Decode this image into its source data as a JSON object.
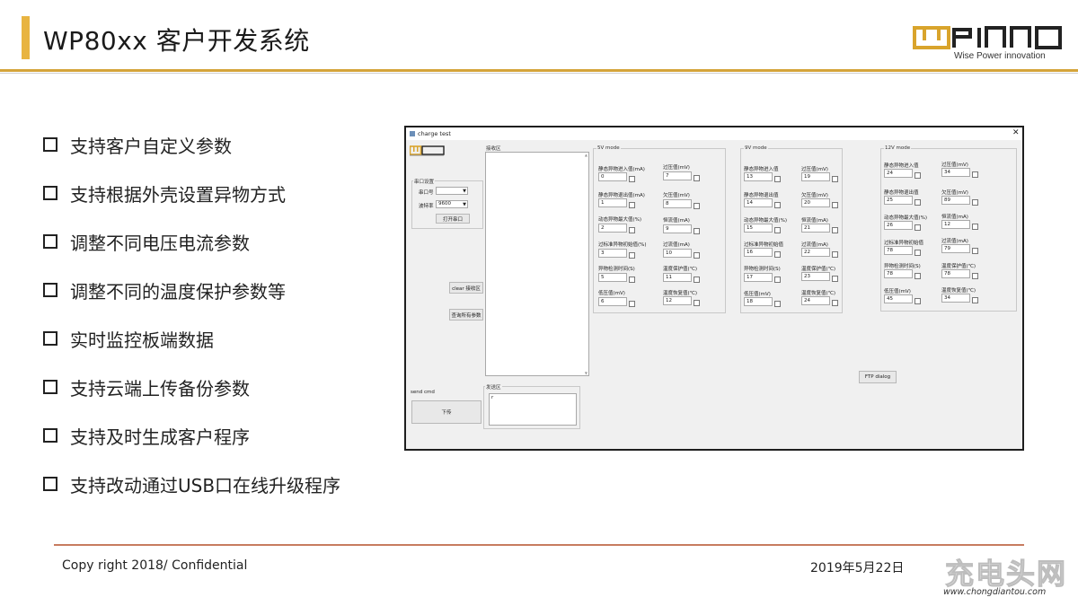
{
  "slide": {
    "title": "WP80xx 客户开发系统",
    "logo_tagline": "Wise Power innovation",
    "bullets": [
      "支持客户自定义参数",
      "支持根据外壳设置异物方式",
      "调整不同电压电流参数",
      "调整不同的温度保护参数等",
      "实时监控板端数据",
      "支持云端上传备份参数",
      "支持及时生成客户程序",
      "支持改动通过USB口在线升级程序"
    ],
    "footer": {
      "copyright": "Copy right 2018/ Confidential",
      "date": "2019年5月22日"
    },
    "watermark": {
      "text": "充电头网",
      "url": "www.chongdiantou.com"
    },
    "colors": {
      "accent": "#e8b441",
      "rule": "#d4a43a",
      "footer_rule": "#c77b5f"
    }
  },
  "app": {
    "window_title": "charge test",
    "close_symbol": "✕",
    "serial": {
      "group_title": "串口设置",
      "port_label": "串口号",
      "port_value": "",
      "baud_label": "波特率",
      "baud_value": "9600",
      "open_button": "打开串口"
    },
    "receive_title": "接收区",
    "send_title": "发送区",
    "send_value": "r",
    "clear_button": "clear 接收区",
    "query_button": "查询所有参数",
    "send_cmd_label": "send cmd",
    "download_button": "下传",
    "ftp_button": "FTP dialog",
    "modes": [
      {
        "title": "5V mode",
        "fields": [
          {
            "label": "静态异物进入值(mA)",
            "value": "0"
          },
          {
            "label": "过压值(mV)",
            "value": "7"
          },
          {
            "label": "静态异物退出值(mA)",
            "value": "1"
          },
          {
            "label": "欠压值(mV)",
            "value": "8"
          },
          {
            "label": "动态异物最大值(%)",
            "value": "2"
          },
          {
            "label": "恒流值(mA)",
            "value": "9"
          },
          {
            "label": "过标准异物初始值(%)",
            "value": "3"
          },
          {
            "label": "过流值(mA)",
            "value": "10"
          },
          {
            "label": "异物检测时间(S)",
            "value": "5"
          },
          {
            "label": "温度保护值(℃)",
            "value": "11"
          },
          {
            "label": "低压值(mV)",
            "value": "6"
          },
          {
            "label": "温度恢复值(℃)",
            "value": "12"
          }
        ]
      },
      {
        "title": "9V mode",
        "fields": [
          {
            "label": "静态异物进入值",
            "value": "13"
          },
          {
            "label": "过压值(mV)",
            "value": "19"
          },
          {
            "label": "静态异物退出值",
            "value": "14"
          },
          {
            "label": "欠压值(mV)",
            "value": "20"
          },
          {
            "label": "动态异物最大值(%)",
            "value": "15"
          },
          {
            "label": "恒流值(mA)",
            "value": "21"
          },
          {
            "label": "过标准异物初始值",
            "value": "16"
          },
          {
            "label": "过流值(mA)",
            "value": "22"
          },
          {
            "label": "异物检测时间(S)",
            "value": "17"
          },
          {
            "label": "温度保护值(℃)",
            "value": "23"
          },
          {
            "label": "低压值(mV)",
            "value": "18"
          },
          {
            "label": "温度恢复值(℃)",
            "value": "24"
          }
        ]
      },
      {
        "title": "12V mode",
        "fields": [
          {
            "label": "静态异物进入值",
            "value": "24"
          },
          {
            "label": "过压值(mV)",
            "value": "34"
          },
          {
            "label": "静态异物退出值",
            "value": "25"
          },
          {
            "label": "欠压值(mV)",
            "value": "89"
          },
          {
            "label": "动态异物最大值(%)",
            "value": "26"
          },
          {
            "label": "恒流值(mA)",
            "value": "12"
          },
          {
            "label": "过标准异物初始值",
            "value": "78"
          },
          {
            "label": "过流值(mA)",
            "value": "79"
          },
          {
            "label": "异物检测时间(S)",
            "value": "78"
          },
          {
            "label": "温度保护值(℃)",
            "value": "78"
          },
          {
            "label": "低压值(mV)",
            "value": "45"
          },
          {
            "label": "温度恢复值(℃)",
            "value": "34"
          }
        ]
      }
    ]
  }
}
